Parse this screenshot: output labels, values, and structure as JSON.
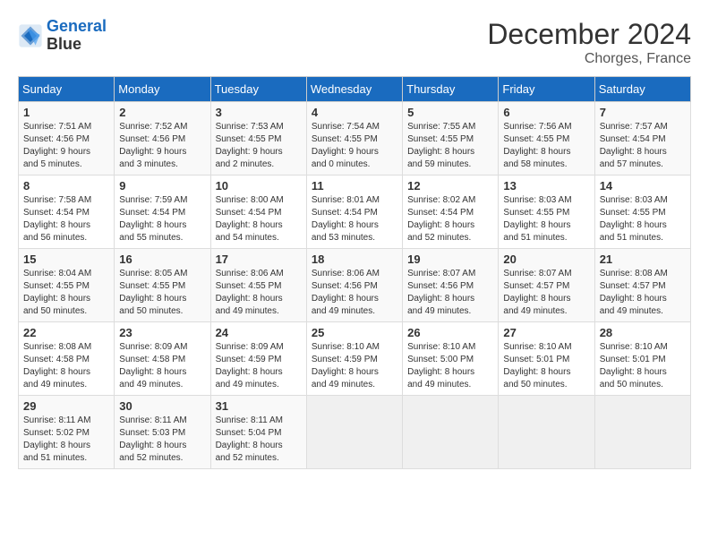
{
  "logo": {
    "line1": "General",
    "line2": "Blue"
  },
  "title": "December 2024",
  "subtitle": "Chorges, France",
  "days_header": [
    "Sunday",
    "Monday",
    "Tuesday",
    "Wednesday",
    "Thursday",
    "Friday",
    "Saturday"
  ],
  "weeks": [
    [
      {
        "day": "1",
        "info": "Sunrise: 7:51 AM\nSunset: 4:56 PM\nDaylight: 9 hours\nand 5 minutes."
      },
      {
        "day": "2",
        "info": "Sunrise: 7:52 AM\nSunset: 4:56 PM\nDaylight: 9 hours\nand 3 minutes."
      },
      {
        "day": "3",
        "info": "Sunrise: 7:53 AM\nSunset: 4:55 PM\nDaylight: 9 hours\nand 2 minutes."
      },
      {
        "day": "4",
        "info": "Sunrise: 7:54 AM\nSunset: 4:55 PM\nDaylight: 9 hours\nand 0 minutes."
      },
      {
        "day": "5",
        "info": "Sunrise: 7:55 AM\nSunset: 4:55 PM\nDaylight: 8 hours\nand 59 minutes."
      },
      {
        "day": "6",
        "info": "Sunrise: 7:56 AM\nSunset: 4:55 PM\nDaylight: 8 hours\nand 58 minutes."
      },
      {
        "day": "7",
        "info": "Sunrise: 7:57 AM\nSunset: 4:54 PM\nDaylight: 8 hours\nand 57 minutes."
      }
    ],
    [
      {
        "day": "8",
        "info": "Sunrise: 7:58 AM\nSunset: 4:54 PM\nDaylight: 8 hours\nand 56 minutes."
      },
      {
        "day": "9",
        "info": "Sunrise: 7:59 AM\nSunset: 4:54 PM\nDaylight: 8 hours\nand 55 minutes."
      },
      {
        "day": "10",
        "info": "Sunrise: 8:00 AM\nSunset: 4:54 PM\nDaylight: 8 hours\nand 54 minutes."
      },
      {
        "day": "11",
        "info": "Sunrise: 8:01 AM\nSunset: 4:54 PM\nDaylight: 8 hours\nand 53 minutes."
      },
      {
        "day": "12",
        "info": "Sunrise: 8:02 AM\nSunset: 4:54 PM\nDaylight: 8 hours\nand 52 minutes."
      },
      {
        "day": "13",
        "info": "Sunrise: 8:03 AM\nSunset: 4:55 PM\nDaylight: 8 hours\nand 51 minutes."
      },
      {
        "day": "14",
        "info": "Sunrise: 8:03 AM\nSunset: 4:55 PM\nDaylight: 8 hours\nand 51 minutes."
      }
    ],
    [
      {
        "day": "15",
        "info": "Sunrise: 8:04 AM\nSunset: 4:55 PM\nDaylight: 8 hours\nand 50 minutes."
      },
      {
        "day": "16",
        "info": "Sunrise: 8:05 AM\nSunset: 4:55 PM\nDaylight: 8 hours\nand 50 minutes."
      },
      {
        "day": "17",
        "info": "Sunrise: 8:06 AM\nSunset: 4:55 PM\nDaylight: 8 hours\nand 49 minutes."
      },
      {
        "day": "18",
        "info": "Sunrise: 8:06 AM\nSunset: 4:56 PM\nDaylight: 8 hours\nand 49 minutes."
      },
      {
        "day": "19",
        "info": "Sunrise: 8:07 AM\nSunset: 4:56 PM\nDaylight: 8 hours\nand 49 minutes."
      },
      {
        "day": "20",
        "info": "Sunrise: 8:07 AM\nSunset: 4:57 PM\nDaylight: 8 hours\nand 49 minutes."
      },
      {
        "day": "21",
        "info": "Sunrise: 8:08 AM\nSunset: 4:57 PM\nDaylight: 8 hours\nand 49 minutes."
      }
    ],
    [
      {
        "day": "22",
        "info": "Sunrise: 8:08 AM\nSunset: 4:58 PM\nDaylight: 8 hours\nand 49 minutes."
      },
      {
        "day": "23",
        "info": "Sunrise: 8:09 AM\nSunset: 4:58 PM\nDaylight: 8 hours\nand 49 minutes."
      },
      {
        "day": "24",
        "info": "Sunrise: 8:09 AM\nSunset: 4:59 PM\nDaylight: 8 hours\nand 49 minutes."
      },
      {
        "day": "25",
        "info": "Sunrise: 8:10 AM\nSunset: 4:59 PM\nDaylight: 8 hours\nand 49 minutes."
      },
      {
        "day": "26",
        "info": "Sunrise: 8:10 AM\nSunset: 5:00 PM\nDaylight: 8 hours\nand 49 minutes."
      },
      {
        "day": "27",
        "info": "Sunrise: 8:10 AM\nSunset: 5:01 PM\nDaylight: 8 hours\nand 50 minutes."
      },
      {
        "day": "28",
        "info": "Sunrise: 8:10 AM\nSunset: 5:01 PM\nDaylight: 8 hours\nand 50 minutes."
      }
    ],
    [
      {
        "day": "29",
        "info": "Sunrise: 8:11 AM\nSunset: 5:02 PM\nDaylight: 8 hours\nand 51 minutes."
      },
      {
        "day": "30",
        "info": "Sunrise: 8:11 AM\nSunset: 5:03 PM\nDaylight: 8 hours\nand 52 minutes."
      },
      {
        "day": "31",
        "info": "Sunrise: 8:11 AM\nSunset: 5:04 PM\nDaylight: 8 hours\nand 52 minutes."
      },
      {
        "day": "",
        "info": ""
      },
      {
        "day": "",
        "info": ""
      },
      {
        "day": "",
        "info": ""
      },
      {
        "day": "",
        "info": ""
      }
    ]
  ]
}
